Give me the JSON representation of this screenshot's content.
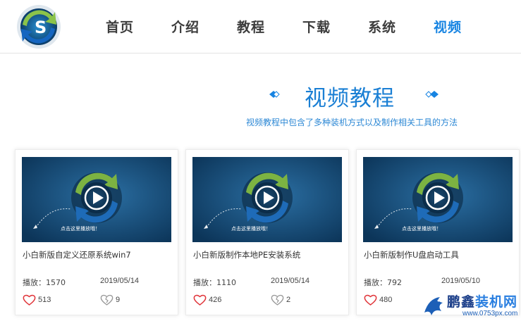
{
  "nav": {
    "items": [
      {
        "label": "首页",
        "active": false
      },
      {
        "label": "介绍",
        "active": false
      },
      {
        "label": "教程",
        "active": false
      },
      {
        "label": "下载",
        "active": false
      },
      {
        "label": "系统",
        "active": false
      },
      {
        "label": "视频",
        "active": true
      }
    ]
  },
  "section": {
    "title": "视频教程",
    "subtitle": "视频教程中包含了多种装机方式以及制作相关工具的方法"
  },
  "thumbnail": {
    "caption": "点击这里播放哦！"
  },
  "cards": [
    {
      "title": "小白新版自定义还原系统win7",
      "plays": "播放：1570",
      "date": "2019/05/14",
      "likes": "513",
      "dislikes": "9"
    },
    {
      "title": "小白新版制作本地PE安装系统",
      "plays": "播放：1110",
      "date": "2019/05/14",
      "likes": "426",
      "dislikes": "2"
    },
    {
      "title": "小白新版制作U盘启动工具",
      "plays": "播放：792",
      "date": "2019/05/10",
      "likes": "480",
      "dislikes": ""
    }
  ],
  "watermark": {
    "brand_a": "鹏鑫",
    "brand_b": "装机网",
    "url": "www.0753px.com"
  },
  "colors": {
    "accent": "#1784e2",
    "thumb_dark": "#0d3d63",
    "heart": "#e0353a"
  }
}
